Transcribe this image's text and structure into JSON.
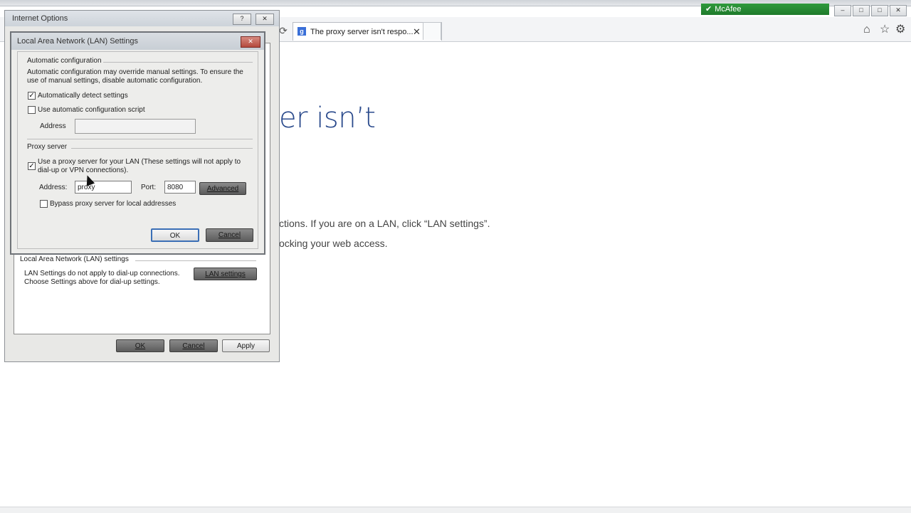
{
  "browser": {
    "tab_title": "The proxy server isn't respo...",
    "tab_close": "✕",
    "refresh_icon": "⟳",
    "addon_label": "McAfee",
    "window_controls": [
      "–",
      "□",
      "✕"
    ],
    "right_icons": [
      "home-icon",
      "star-icon",
      "gear-icon"
    ]
  },
  "page": {
    "heading_partial": "er isn’t",
    "line1_partial": "ctions. If you are on a LAN, click “LAN settings”.",
    "line2_partial": "ocking your web access."
  },
  "internet_options": {
    "title": "Internet Options",
    "help": "?",
    "close": "✕",
    "lan_section": {
      "title": "Local Area Network (LAN) settings",
      "description": "LAN Settings do not apply to dial-up connections. Choose Settings above for dial-up settings.",
      "button": "LAN settings"
    },
    "buttons": {
      "ok": "OK",
      "cancel": "Cancel",
      "apply": "Apply"
    }
  },
  "lan_dialog": {
    "title": "Local Area Network (LAN) Settings",
    "close": "✕",
    "auto_config": {
      "heading": "Automatic configuration",
      "description": "Automatic configuration may override manual settings.  To ensure the use of manual settings, disable automatic configuration.",
      "auto_detect_label": "Automatically detect settings",
      "auto_detect_checked": true,
      "use_script_label": "Use automatic configuration script",
      "use_script_checked": false,
      "address_label": "Address",
      "address_value": ""
    },
    "proxy": {
      "heading": "Proxy server",
      "use_proxy_label": "Use a proxy server for your LAN (These settings will not apply to dial-up or VPN connections).",
      "use_proxy_checked": true,
      "address_label": "Address:",
      "address_value": "proxy",
      "port_label": "Port:",
      "port_value": "8080",
      "advanced_button": "Advanced",
      "bypass_label": "Bypass proxy server for local addresses",
      "bypass_checked": false
    },
    "buttons": {
      "ok": "OK",
      "cancel": "Cancel"
    }
  }
}
